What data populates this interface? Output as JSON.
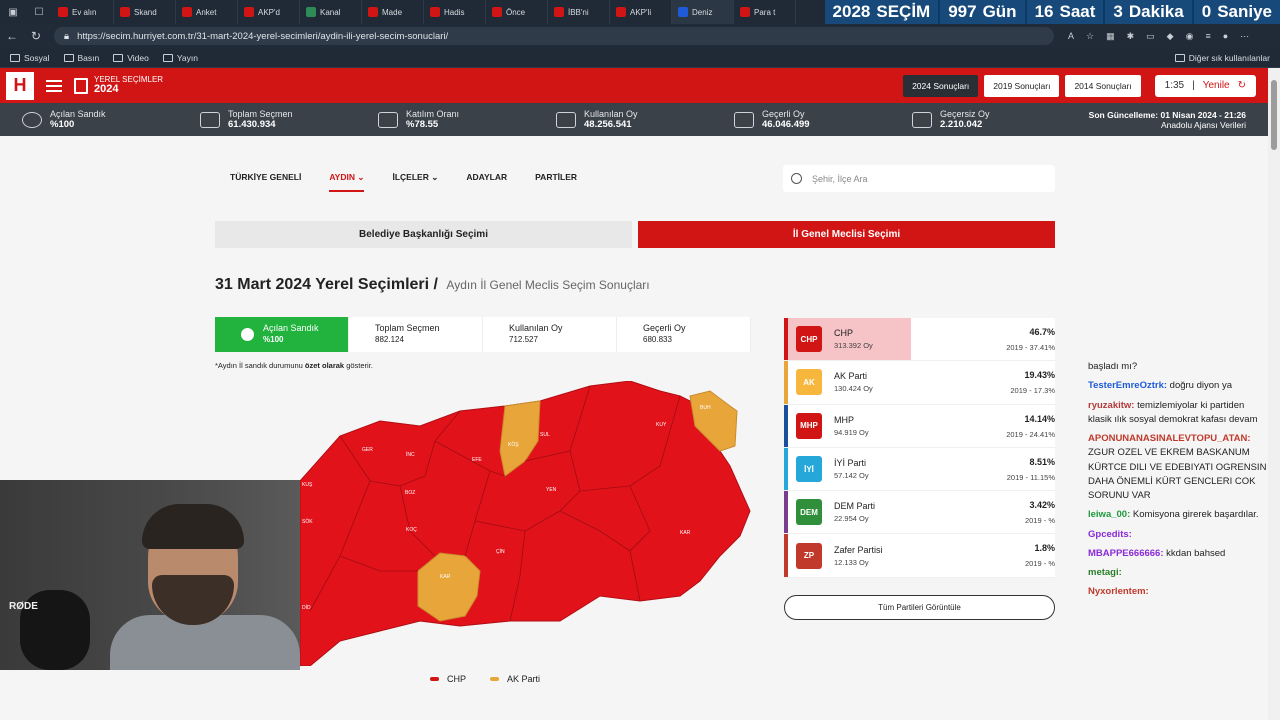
{
  "browser": {
    "tabs": [
      {
        "label": "Ev alın",
        "color": "#d11414"
      },
      {
        "label": "Skand",
        "color": "#d11414"
      },
      {
        "label": "Anket",
        "color": "#d11414"
      },
      {
        "label": "AKP'd",
        "color": "#d11414"
      },
      {
        "label": "Kanal",
        "color": "#2e8b57"
      },
      {
        "label": "Made",
        "color": "#d11414"
      },
      {
        "label": "Hadis",
        "color": "#d11414"
      },
      {
        "label": "Önce",
        "color": "#d11414"
      },
      {
        "label": "İBB'ni",
        "color": "#d11414"
      },
      {
        "label": "AKP'li",
        "color": "#d11414"
      },
      {
        "label": "Deniz",
        "color": "#1e5bd8"
      },
      {
        "label": "Para t",
        "color": "#d11414"
      }
    ],
    "countdown": {
      "year": "2028",
      "year_label": "SEÇİM",
      "days": "997",
      "days_label": "Gün",
      "hours": "16",
      "hours_label": "Saat",
      "minutes": "3",
      "minutes_label": "Dakika",
      "seconds": "0",
      "seconds_label": "Saniye"
    },
    "url": "https://secim.hurriyet.com.tr/31-mart-2024-yerel-secimleri/aydin-ili-yerel-secim-sonuclari/",
    "bookmarks": [
      "Sosyal",
      "Basın",
      "Video",
      "Yayın"
    ],
    "other_bookmarks": "Diğer sık kullanılanlar"
  },
  "header": {
    "logo": "H",
    "small": "YEREL SEÇİMLER",
    "year": "2024",
    "btn_2024": "2024 Sonuçları",
    "btn_2019": "2019 Sonuçları",
    "btn_2014": "2014 Sonuçları",
    "timer": "1:35",
    "refresh": "Yenile"
  },
  "stats": {
    "opened_label": "Açılan Sandık",
    "opened": "%100",
    "voters_label": "Toplam Seçmen",
    "voters": "61.430.934",
    "turnout_label": "Katılım Oranı",
    "turnout": "%78.55",
    "used_label": "Kullanılan Oy",
    "used": "48.256.541",
    "valid_label": "Geçerli Oy",
    "valid": "46.046.499",
    "invalid_label": "Geçersiz Oy",
    "invalid": "2.210.042",
    "last_update": "Son Güncelleme: 01 Nisan 2024 - 21:26",
    "source": "Anadolu Ajansı Verileri"
  },
  "nav": {
    "items": [
      "TÜRKİYE GENELİ",
      "AYDIN",
      "İLÇELER",
      "ADAYLAR",
      "PARTİLER"
    ],
    "search_placeholder": "Şehir, İlçe Ara"
  },
  "tabs": {
    "mayor": "Belediye Başkanlığı Seçimi",
    "council": "İl Genel Meclisi Seçimi"
  },
  "page": {
    "title": "31 Mart 2024 Yerel Seçimleri /",
    "subtitle": "Aydın İl Genel Meclis Seçim Sonuçları",
    "note_a": "*Aydın İl sandık durumunu ",
    "note_b": "özet olarak",
    "note_c": " gösterir."
  },
  "local_stats": {
    "opened_label": "Açılan Sandık",
    "opened": "%100",
    "voters_label": "Toplam Seçmen",
    "voters": "882.124",
    "used_label": "Kullanılan Oy",
    "used": "712.527",
    "valid_label": "Geçerli Oy",
    "valid": "680.833"
  },
  "parties": [
    {
      "name": "CHP",
      "votes": "313.392 Oy",
      "pct": "46.7%",
      "prev": "2019 - 37.41%",
      "color": "#d11414",
      "logo_bg": "#d11414",
      "logo": "CHP",
      "share": 0.467
    },
    {
      "name": "AK Parti",
      "votes": "130.424 Oy",
      "pct": "19.43%",
      "prev": "2019 - 17.3%",
      "color": "#e8a53a",
      "logo_bg": "#f6b73c",
      "logo": "AK",
      "share": 0.1943
    },
    {
      "name": "MHP",
      "votes": "94.919 Oy",
      "pct": "14.14%",
      "prev": "2019 - 24.41%",
      "color": "#1a4f9c",
      "logo_bg": "#d11414",
      "logo": "MHP",
      "share": 0.1414
    },
    {
      "name": "İYİ Parti",
      "votes": "57.142 Oy",
      "pct": "8.51%",
      "prev": "2019 - 11.15%",
      "color": "#25a7d9",
      "logo_bg": "#25a7d9",
      "logo": "İYİ",
      "share": 0.0851
    },
    {
      "name": "DEM Parti",
      "votes": "22.954 Oy",
      "pct": "3.42%",
      "prev": "2019 - %",
      "color": "#7a3c8c",
      "logo_bg": "#2f8f3a",
      "logo": "DEM",
      "share": 0.0342
    },
    {
      "name": "Zafer Partisi",
      "votes": "12.133 Oy",
      "pct": "1.8%",
      "prev": "2019 - %",
      "color": "#c0392b",
      "logo_bg": "#c0392b",
      "logo": "ZP",
      "share": 0.018
    }
  ],
  "all_parties_btn": "Tüm Partileri Görüntüle",
  "map": {
    "districts": [
      {
        "name": "GER",
        "party": "CHP"
      },
      {
        "name": "İNC",
        "party": "CHP"
      },
      {
        "name": "EFE",
        "party": "CHP"
      },
      {
        "name": "KÖŞ",
        "party": "AK Parti"
      },
      {
        "name": "SUL",
        "party": "CHP"
      },
      {
        "name": "BOZ",
        "party": "CHP"
      },
      {
        "name": "KUY",
        "party": "CHP"
      },
      {
        "name": "BUH",
        "party": "AK Parti"
      },
      {
        "name": "YEN",
        "party": "CHP"
      },
      {
        "name": "KOÇ",
        "party": "CHP"
      },
      {
        "name": "ÇİN",
        "party": "CHP"
      },
      {
        "name": "KAR",
        "party": "CHP"
      },
      {
        "name": "KAR",
        "party": "AK Parti"
      },
      {
        "name": "KUŞ",
        "party": "CHP"
      },
      {
        "name": "SÖK",
        "party": "CHP"
      },
      {
        "name": "DİD",
        "party": "CHP"
      }
    ],
    "legend": [
      {
        "label": "CHP",
        "color": "#d11414"
      },
      {
        "label": "AK Parti",
        "color": "#e8a53a"
      }
    ]
  },
  "webcam": {
    "brand": "RØDE"
  },
  "chat": [
    {
      "user": "",
      "text": "başladı mı?"
    },
    {
      "user": "TesterEmreOztrk:",
      "text": "doğru diyon ya"
    },
    {
      "user": "ryuzakitw:",
      "text": "temizlemiyolar ki partiden klasik ılık sosyal demokrat kafası devam"
    },
    {
      "user": "APONUNANASINALEVTOPU_ATAN:",
      "text": "ZGUR OZEL VE EKREM BASKANUM KÜRTCE DILI VE EDEBIYATI OGRENSIN DAHA ÖNEMLİ KÜRT GENCLERI COK SORUNU VAR"
    },
    {
      "user": "leiwa_00:",
      "text": "Komisyona girerek başardılar."
    },
    {
      "user": "Gpcedits:",
      "text": ""
    },
    {
      "user": "MBAPPE666666:",
      "text": "kkdan bahsed"
    },
    {
      "user": "metagi:",
      "text": ""
    },
    {
      "user": "Nyxorlentem:",
      "text": ""
    }
  ]
}
